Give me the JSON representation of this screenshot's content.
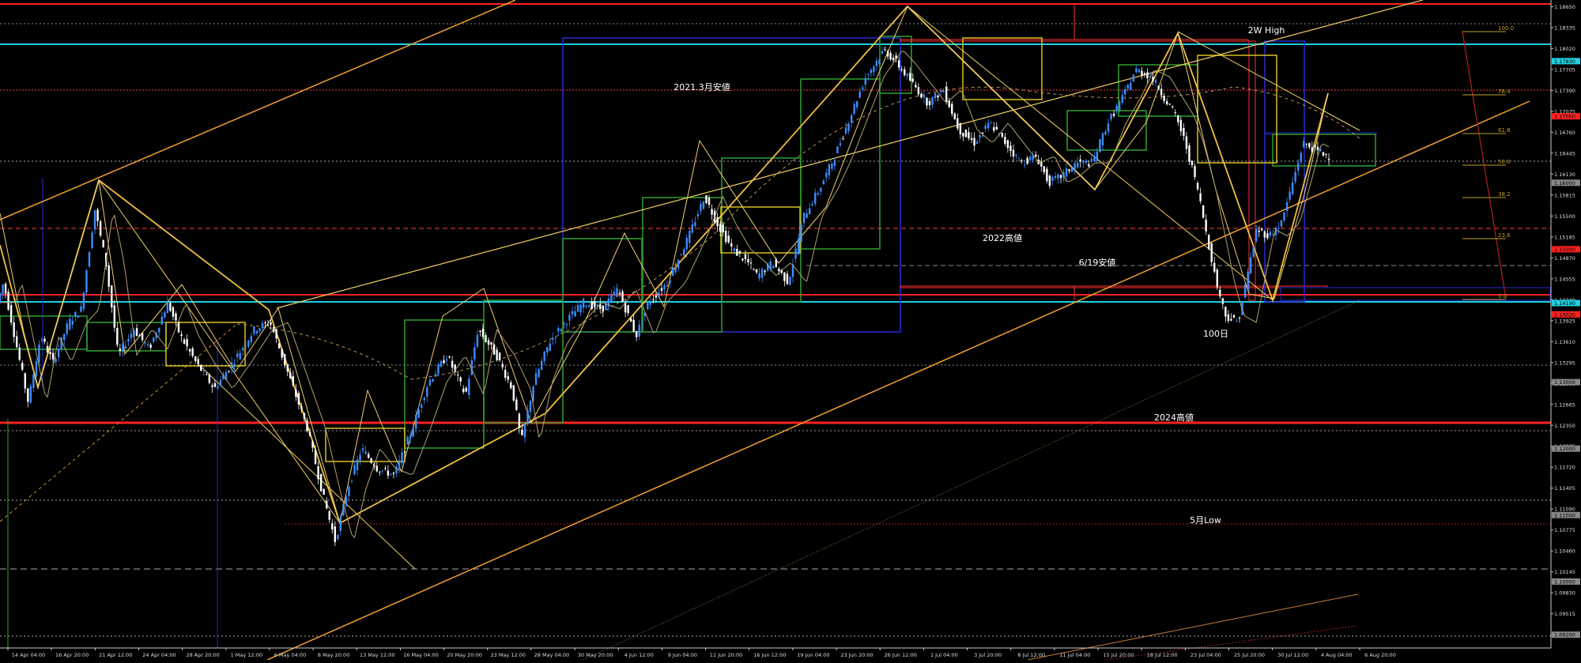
{
  "chart_data": {
    "type": "candlestick",
    "title": "",
    "ylim": [
      1.09,
      1.1875
    ],
    "y_ticks": [
      "1.18650",
      "1.18335",
      "1.18020",
      "1.17705",
      "1.17390",
      "1.17075",
      "1.16760",
      "1.16445",
      "1.16130",
      "1.15815",
      "1.15500",
      "1.15185",
      "1.14870",
      "1.14555",
      "1.14240",
      "1.13925",
      "1.13610",
      "1.13295",
      "1.12980",
      "1.12665",
      "1.12350",
      "1.12035",
      "1.11720",
      "1.11405",
      "1.11090",
      "1.10775",
      "1.10460",
      "1.10145",
      "1.09830",
      "1.09515",
      "1.09200"
    ],
    "x_ticks": [
      "14 Apr 04:00",
      "16 Apr 20:00",
      "21 Apr 12:00",
      "24 Apr 04:00",
      "28 Apr 20:00",
      "1 May 12:00",
      "6 May 04:00",
      "8 May 20:00",
      "13 May 12:00",
      "16 May 04:00",
      "20 May 20:00",
      "23 May 12:00",
      "28 May 04:00",
      "30 May 20:00",
      "4 Jun 12:00",
      "9 Jun 04:00",
      "11 Jun 20:00",
      "16 Jun 12:00",
      "19 Jun 04:00",
      "23 Jun 20:00",
      "26 Jun 12:00",
      "1 Jul 04:00",
      "3 Jul 20:00",
      "8 Jul 12:00",
      "11 Jul 04:00",
      "15 Jul 20:00",
      "18 Jul 12:00",
      "23 Jul 04:00",
      "25 Jul 20:00",
      "30 Jul 12:00",
      "4 Aug 04:00",
      "6 Aug 20:00"
    ],
    "price_path": [
      [
        0,
        1.142
      ],
      [
        0.004,
        1.145
      ],
      [
        0.012,
        1.136
      ],
      [
        0.02,
        1.127
      ],
      [
        0.028,
        1.137
      ],
      [
        0.036,
        1.133
      ],
      [
        0.046,
        1.139
      ],
      [
        0.054,
        1.141
      ],
      [
        0.063,
        1.156
      ],
      [
        0.07,
        1.148
      ],
      [
        0.078,
        1.134
      ],
      [
        0.088,
        1.138
      ],
      [
        0.098,
        1.135
      ],
      [
        0.11,
        1.142
      ],
      [
        0.118,
        1.137
      ],
      [
        0.128,
        1.133
      ],
      [
        0.14,
        1.129
      ],
      [
        0.152,
        1.133
      ],
      [
        0.166,
        1.138
      ],
      [
        0.176,
        1.139
      ],
      [
        0.188,
        1.131
      ],
      [
        0.2,
        1.123
      ],
      [
        0.21,
        1.113
      ],
      [
        0.218,
        1.106
      ],
      [
        0.226,
        1.114
      ],
      [
        0.235,
        1.12
      ],
      [
        0.245,
        1.117
      ],
      [
        0.256,
        1.116
      ],
      [
        0.266,
        1.122
      ],
      [
        0.278,
        1.13
      ],
      [
        0.29,
        1.134
      ],
      [
        0.302,
        1.128
      ],
      [
        0.31,
        1.138
      ],
      [
        0.322,
        1.134
      ],
      [
        0.332,
        1.129
      ],
      [
        0.338,
        1.121
      ],
      [
        0.346,
        1.13
      ],
      [
        0.356,
        1.136
      ],
      [
        0.366,
        1.139
      ],
      [
        0.378,
        1.142
      ],
      [
        0.39,
        1.141
      ],
      [
        0.4,
        1.144
      ],
      [
        0.412,
        1.137
      ],
      [
        0.42,
        1.142
      ],
      [
        0.432,
        1.145
      ],
      [
        0.446,
        1.152
      ],
      [
        0.456,
        1.158
      ],
      [
        0.464,
        1.154
      ],
      [
        0.474,
        1.15
      ],
      [
        0.484,
        1.148
      ],
      [
        0.49,
        1.146
      ],
      [
        0.5,
        1.148
      ],
      [
        0.51,
        1.145
      ],
      [
        0.52,
        1.155
      ],
      [
        0.53,
        1.159
      ],
      [
        0.54,
        1.164
      ],
      [
        0.55,
        1.17
      ],
      [
        0.56,
        1.176
      ],
      [
        0.572,
        1.18
      ],
      [
        0.58,
        1.178
      ],
      [
        0.59,
        1.175
      ],
      [
        0.6,
        1.172
      ],
      [
        0.61,
        1.174
      ],
      [
        0.62,
        1.168
      ],
      [
        0.63,
        1.166
      ],
      [
        0.64,
        1.169
      ],
      [
        0.65,
        1.166
      ],
      [
        0.66,
        1.163
      ],
      [
        0.67,
        1.164
      ],
      [
        0.678,
        1.16
      ],
      [
        0.686,
        1.161
      ],
      [
        0.696,
        1.163
      ],
      [
        0.706,
        1.163
      ],
      [
        0.716,
        1.169
      ],
      [
        0.726,
        1.173
      ],
      [
        0.734,
        1.177
      ],
      [
        0.744,
        1.176
      ],
      [
        0.752,
        1.173
      ],
      [
        0.76,
        1.17
      ],
      [
        0.766,
        1.166
      ],
      [
        0.774,
        1.159
      ],
      [
        0.78,
        1.152
      ],
      [
        0.786,
        1.145
      ],
      [
        0.792,
        1.14
      ],
      [
        0.8,
        1.139
      ],
      [
        0.806,
        1.146
      ],
      [
        0.812,
        1.153
      ],
      [
        0.82,
        1.152
      ],
      [
        0.828,
        1.154
      ],
      [
        0.834,
        1.159
      ],
      [
        0.842,
        1.166
      ],
      [
        0.85,
        1.165
      ],
      [
        0.858,
        1.164
      ]
    ],
    "annotations": [
      "2W High",
      "2021.3月安値",
      "2022高値",
      "6/19安値",
      "100日",
      "2024高値",
      "5月Low"
    ],
    "fib_levels": [
      "100.0",
      "76.4",
      "61.8",
      "50.0",
      "38.2",
      "23.6",
      "0.0"
    ],
    "hline_prices": [
      "1.17830",
      "1.17000",
      "1.16000",
      "1.15000",
      "1.14190",
      "1.14020",
      "1.13000",
      "1.12000",
      "1.11000",
      "1.10000",
      "1.09200"
    ],
    "grid": false,
    "colors": {
      "background": "#000000",
      "bull": "#3c8dff",
      "bear": "#ffffff",
      "trend": "#f0c040",
      "channel": "#f0a030",
      "level_red": "#ff2020",
      "level_cyan": "#20d0e0",
      "box_green": "#2fa02f",
      "box_blue": "#2a2ad0",
      "box_yellow": "#d8c020"
    }
  }
}
